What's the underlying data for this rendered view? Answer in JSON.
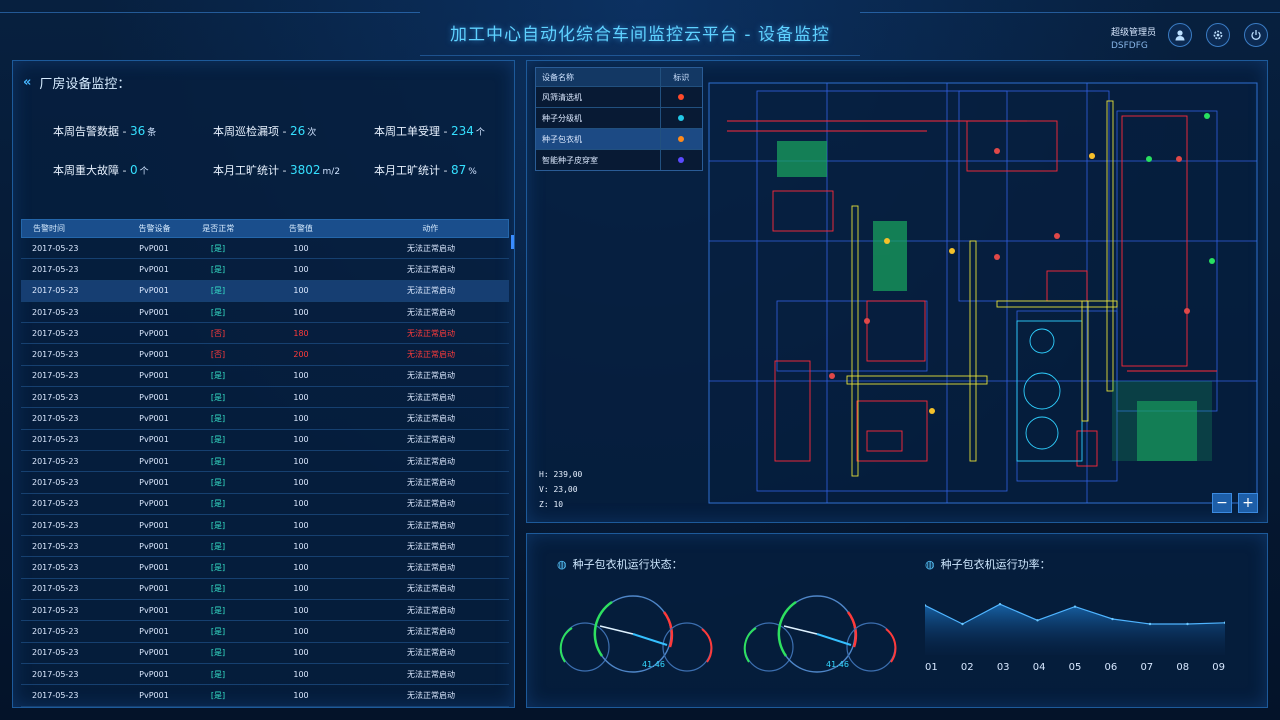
{
  "header": {
    "title": "加工中心自动化综合车间监控云平台 - 设备监控",
    "user_role": "超级管理员",
    "user_name": "DSFDFG",
    "icons": [
      "user-icon",
      "gear-icon",
      "power-icon"
    ]
  },
  "left": {
    "section_title": "厂房设备监控：",
    "stats": [
      {
        "label": "本周告警数据 - ",
        "value": "36",
        "unit": "条"
      },
      {
        "label": "本周巡检漏项 - ",
        "value": "26",
        "unit": "次"
      },
      {
        "label": "本周工单受理 - ",
        "value": "234",
        "unit": "个"
      },
      {
        "label": "本周重大故障 - ",
        "value": "0",
        "unit": "个"
      },
      {
        "label": "本月工旷统计 - ",
        "value": "3802",
        "unit": "m/2"
      },
      {
        "label": "本月工旷统计 - ",
        "value": "87",
        "unit": "%"
      }
    ],
    "table": {
      "headers": [
        "告警时间",
        "告警设备",
        "是否正常",
        "告警值",
        "动作"
      ],
      "rows": [
        [
          "2017-05-23",
          "PvP001",
          "[是]",
          "100",
          "无法正常启动"
        ],
        [
          "2017-05-23",
          "PvP001",
          "[是]",
          "100",
          "无法正常启动"
        ],
        [
          "2017-05-23",
          "PvP001",
          "[是]",
          "100",
          "无法正常启动"
        ],
        [
          "2017-05-23",
          "PvP001",
          "[是]",
          "100",
          "无法正常启动"
        ],
        [
          "2017-05-23",
          "PvP001",
          "[否]",
          "180",
          "无法正常启动"
        ],
        [
          "2017-05-23",
          "PvP001",
          "[否]",
          "200",
          "无法正常启动"
        ],
        [
          "2017-05-23",
          "PvP001",
          "[是]",
          "100",
          "无法正常启动"
        ],
        [
          "2017-05-23",
          "PvP001",
          "[是]",
          "100",
          "无法正常启动"
        ],
        [
          "2017-05-23",
          "PvP001",
          "[是]",
          "100",
          "无法正常启动"
        ],
        [
          "2017-05-23",
          "PvP001",
          "[是]",
          "100",
          "无法正常启动"
        ],
        [
          "2017-05-23",
          "PvP001",
          "[是]",
          "100",
          "无法正常启动"
        ],
        [
          "2017-05-23",
          "PvP001",
          "[是]",
          "100",
          "无法正常启动"
        ],
        [
          "2017-05-23",
          "PvP001",
          "[是]",
          "100",
          "无法正常启动"
        ],
        [
          "2017-05-23",
          "PvP001",
          "[是]",
          "100",
          "无法正常启动"
        ],
        [
          "2017-05-23",
          "PvP001",
          "[是]",
          "100",
          "无法正常启动"
        ],
        [
          "2017-05-23",
          "PvP001",
          "[是]",
          "100",
          "无法正常启动"
        ],
        [
          "2017-05-23",
          "PvP001",
          "[是]",
          "100",
          "无法正常启动"
        ],
        [
          "2017-05-23",
          "PvP001",
          "[是]",
          "100",
          "无法正常启动"
        ],
        [
          "2017-05-23",
          "PvP001",
          "[是]",
          "100",
          "无法正常启动"
        ],
        [
          "2017-05-23",
          "PvP001",
          "[是]",
          "100",
          "无法正常启动"
        ],
        [
          "2017-05-23",
          "PvP001",
          "[是]",
          "100",
          "无法正常启动"
        ],
        [
          "2017-05-23",
          "PvP001",
          "[是]",
          "100",
          "无法正常启动"
        ]
      ],
      "alarm_rows": [
        4,
        5
      ],
      "highlight_row": 2
    }
  },
  "map": {
    "legend_headers": [
      "设备名称",
      "标识"
    ],
    "legend_items": [
      {
        "name": "风筛清选机",
        "color": "#ff4a2a"
      },
      {
        "name": "种子分级机",
        "color": "#22c8e8"
      },
      {
        "name": "种子包衣机",
        "color": "#ff8a1a"
      },
      {
        "name": "智能种子皮穿室",
        "color": "#5a4aff"
      }
    ],
    "active_legend": 2,
    "coord_h": "H: 239,00",
    "coord_v": "V: 23,00",
    "coord_z": "Z: 10",
    "zoom_out": "−",
    "zoom_in": "+"
  },
  "bottom": {
    "status_title": "种子包衣机运行状态：",
    "power_title": "种子包衣机运行功率：",
    "gauge_readout": "41.46",
    "chart_data": {
      "type": "area",
      "categories": [
        "01",
        "02",
        "03",
        "04",
        "05",
        "06",
        "07",
        "08",
        "09"
      ],
      "values": [
        80,
        50,
        82,
        56,
        78,
        58,
        50,
        50,
        52
      ],
      "ylim": [
        0,
        100
      ],
      "title": "",
      "xlabel": "",
      "ylabel": ""
    }
  }
}
